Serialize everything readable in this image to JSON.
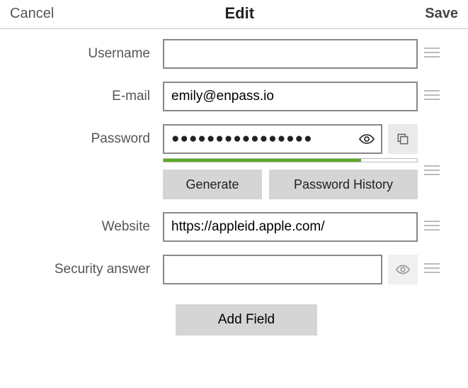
{
  "header": {
    "cancel": "Cancel",
    "title": "Edit",
    "save": "Save"
  },
  "fields": {
    "username": {
      "label": "Username",
      "value": ""
    },
    "email": {
      "label": "E-mail",
      "value": "emily@enpass.io"
    },
    "password": {
      "label": "Password",
      "value": "●●●●●●●●●●●●●●●●"
    },
    "website": {
      "label": "Website",
      "value": "https://appleid.apple.com/"
    },
    "security_answer": {
      "label": "Security answer",
      "value": ""
    }
  },
  "buttons": {
    "generate": "Generate",
    "history": "Password History",
    "add_field": "Add Field"
  },
  "password_strength_percent": 78
}
